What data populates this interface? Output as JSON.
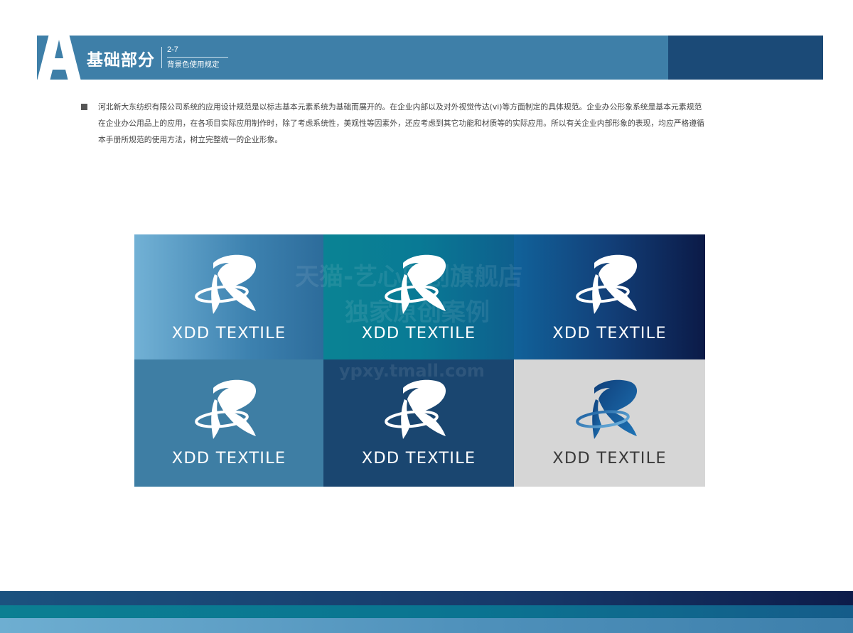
{
  "header": {
    "letter": "A",
    "title": "基础部分",
    "code": "2-7",
    "subtitle": "背景色使用规定"
  },
  "intro": {
    "text": "河北新大东纺织有限公司系统的应用设计规范是以标志基本元素系统为基础而展开的。在企业内部以及对外视觉传达(vi)等方面制定的具体规范。企业办公形象系统是基本元素规范在企业办公用品上的应用，在各项目实际应用制作时，除了考虑系统性，美观性等因素外，还应考虑到其它功能和材质等的实际应用。所以有关企业内部形象的表现，均应严格遵循本手册所规范的使用方法，树立完整统一的企业形象。"
  },
  "logo_grid": {
    "brand_name": "XDD TEXTILE",
    "cells": [
      {
        "background": "gradient #6fb0d4 → #2e6e9c",
        "text_color": "#ffffff"
      },
      {
        "background": "gradient #0a7f95 → #0d5a86",
        "text_color": "#ffffff"
      },
      {
        "background": "gradient #12609a → #0b1a48",
        "text_color": "#ffffff"
      },
      {
        "background": "#3e7ea4",
        "text_color": "#ffffff"
      },
      {
        "background": "#1a4670",
        "text_color": "#ffffff"
      },
      {
        "background": "#d6d6d6",
        "text_color": "#3a3a3a"
      }
    ]
  },
  "watermark": {
    "line1": "天猫-艺心印创旗舰店",
    "line2": "独家原创案例",
    "line3": "ypxy.tmall.com"
  },
  "colors": {
    "primary_blue": "#3e7fa8",
    "dark_navy": "#1b4a77",
    "teal": "#0a7f95"
  }
}
